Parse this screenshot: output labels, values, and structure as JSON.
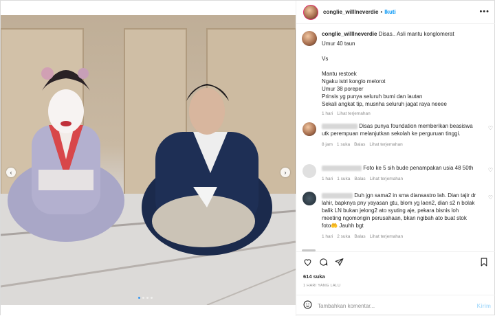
{
  "header": {
    "username": "conglie_willlneverdie",
    "separator": "•",
    "follow_label": "Ikuti",
    "more_icon": "more-horizontal-icon",
    "more_glyph": "•••"
  },
  "caption": {
    "username": "conglie_willlneverdie",
    "first_line": "Disas.. Asli mantu konglomerat",
    "lines": [
      "Umur 40 taun",
      "",
      "Vs",
      "",
      "Mantu restoek",
      "Ngaku istri konglo melorot",
      "Umur 38 poreper",
      "Prinsis yg punya seluruh bumi dan lautan",
      "Sekali angkat tip, musnha seluruh jagat raya neeee"
    ],
    "time": "1 hari",
    "translate": "Lihat terjemahan"
  },
  "comments": [
    {
      "text": "Disas punya foundation memberikan beasiswa utk perempuan melanjutkan sekolah ke perguruan tinggi.",
      "time": "8 jam",
      "likes": "1 suka",
      "reply": "Balas",
      "translate": "Lihat terjemahan"
    },
    {
      "text": "Foto ke 5 sih bude penampakan usia 48 50th",
      "time": "1 hari",
      "likes": "1 suka",
      "reply": "Balas",
      "translate": "Lihat terjemahan"
    },
    {
      "text": "Duh jgn sama2 in sma diansastro lah. Dian tajir dr lahir, bapknya pny yayasan gtu, blom yg laen2, dian s2 n bolak balik LN bukan jelong2 ato syuting aje, pekara bisnis loh meeting ngomongin perusahaan, bkan ngibah ato buat stok foto🤲 Jauhh bgt",
      "time": "1 hari",
      "likes": "2 suka",
      "reply": "Balas",
      "translate": "Lihat terjemahan"
    }
  ],
  "actions": {
    "like_icon": "heart-icon",
    "comment_icon": "comment-icon",
    "share_icon": "send-icon",
    "save_icon": "bookmark-icon"
  },
  "likes_count": "614 suka",
  "posted_time": "1 HARI YANG LALU",
  "add_comment": {
    "emoji_icon": "smiley-icon",
    "placeholder": "Tambahkan komentar...",
    "post_label": "Kirim"
  },
  "media": {
    "prev_glyph": "‹",
    "next_glyph": "›",
    "carousel_dots": 4,
    "active_dot": 0
  }
}
